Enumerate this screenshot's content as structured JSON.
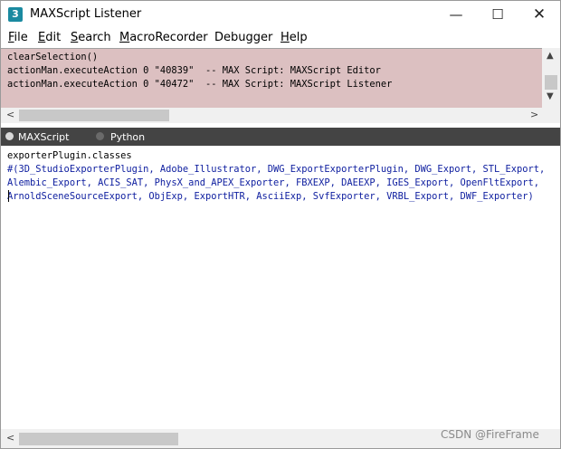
{
  "window": {
    "title": "MAXScript Listener",
    "icon_label": "3",
    "controls": {
      "minimize": "—",
      "maximize": "☐",
      "close": "✕"
    }
  },
  "menu": [
    {
      "accel": "F",
      "rest": "ile"
    },
    {
      "accel": "E",
      "rest": "dit"
    },
    {
      "accel": "S",
      "rest": "earch"
    },
    {
      "accel": "M",
      "rest": "acroRecorder"
    },
    {
      "accel": "",
      "rest": "Debugger"
    },
    {
      "accel": "H",
      "rest": "elp"
    }
  ],
  "macro_recorder": {
    "lines": [
      "clearSelection()",
      "actionMan.executeAction 0 \"40839\"  -- MAX Script: MAXScript Editor",
      "actionMan.executeAction 0 \"40472\"  -- MAX Script: MAXScript Listener"
    ]
  },
  "language_tabs": {
    "maxscript": "MAXScript",
    "python": "Python",
    "selected": "MAXScript"
  },
  "output": {
    "command": "exporterPlugin.classes",
    "result_lines": [
      "#(3D_StudioExporterPlugin, Adobe_Illustrator, DWG_ExportExporterPlugin, DWG_Export, STL_Export,",
      "Alembic_Export, ACIS_SAT, PhysX_and_APEX_Exporter, FBXEXP, DAEEXP, IGES_Export, OpenFltExport,",
      "ArnoldSceneSourceExport, ObjExp, ExportHTR, AsciiExp, SvfExporter, VRBL_Export, DWF_Exporter)"
    ]
  },
  "watermark": "CSDN @FireFrame",
  "colors": {
    "macro_pane_bg": "#dcc0c1",
    "tab_bar_bg": "#444444",
    "result_text": "#1020a0"
  }
}
